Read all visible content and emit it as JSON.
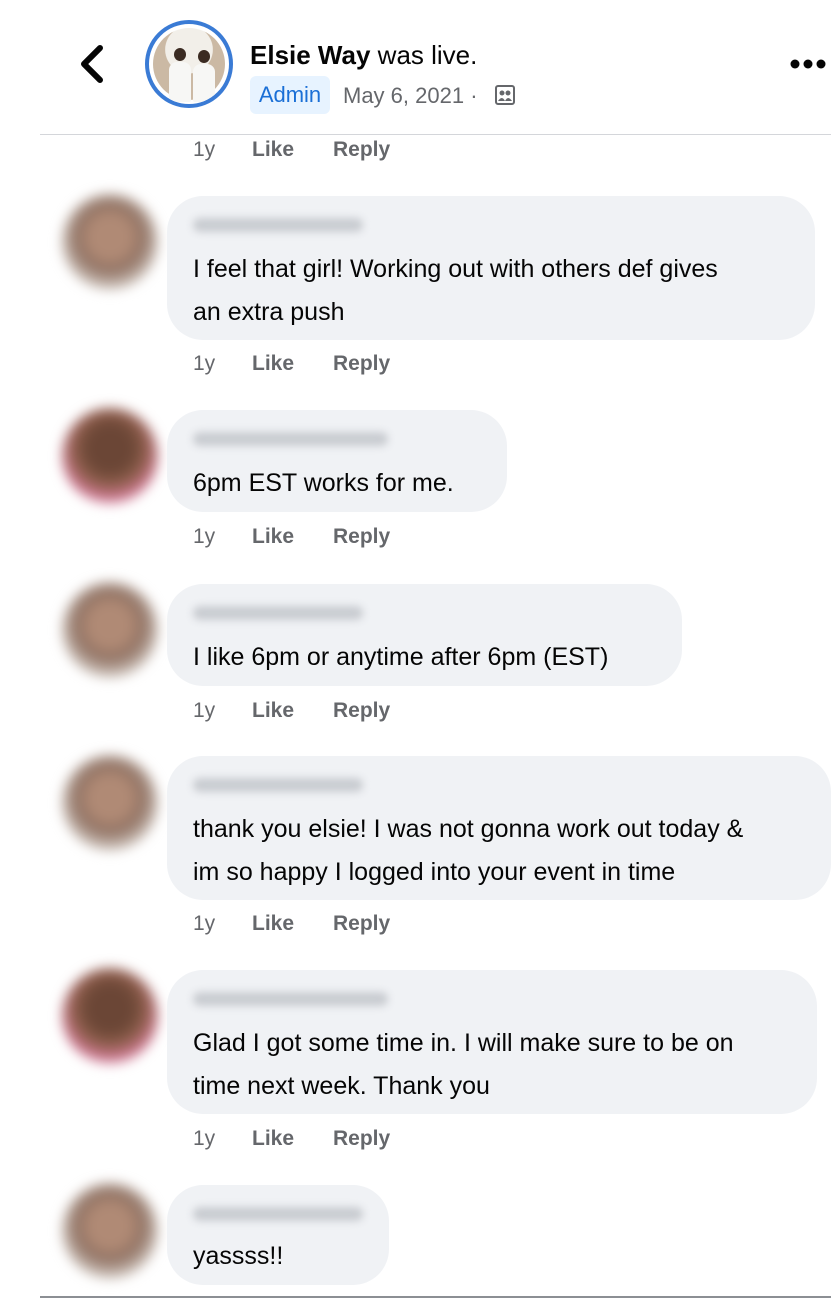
{
  "header": {
    "author": "Elsie Way",
    "action": " was live.",
    "badge": "Admin",
    "date": "May 6, 2021 ·",
    "back_icon": "chevron-left-icon",
    "privacy_icon": "group-icon",
    "more_icon": "more-horizontal-icon"
  },
  "top_meta": {
    "time": "1y",
    "like": "Like",
    "reply": "Reply"
  },
  "comments": [
    {
      "lines": [
        "I feel that girl! Working out with others def gives",
        "an extra push"
      ],
      "time": "1y",
      "like": "Like",
      "reply": "Reply"
    },
    {
      "lines": [
        "6pm EST works for me."
      ],
      "time": "1y",
      "like": "Like",
      "reply": "Reply"
    },
    {
      "lines": [
        "I like 6pm or anytime after 6pm (EST)"
      ],
      "time": "1y",
      "like": "Like",
      "reply": "Reply"
    },
    {
      "lines": [
        "thank you elsie! I was not gonna work out today &",
        "im so happy I logged into your event in time"
      ],
      "time": "1y",
      "like": "Like",
      "reply": "Reply"
    },
    {
      "lines": [
        "Glad I got some time in. I will make sure to be on",
        "time next week. Thank you"
      ],
      "time": "1y",
      "like": "Like",
      "reply": "Reply"
    },
    {
      "lines": [
        "yassss!!"
      ]
    }
  ],
  "colors": {
    "accent": "#1a6fd6",
    "bubble": "#f0f2f5",
    "meta": "#65676b"
  }
}
